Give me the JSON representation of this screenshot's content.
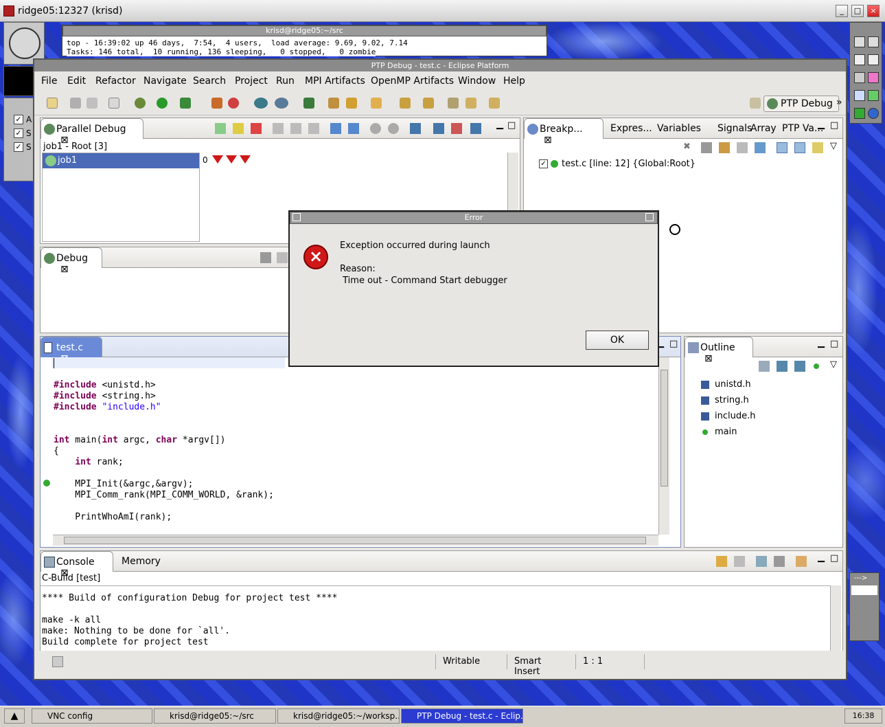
{
  "x_window": {
    "title": "ridge05:12327 (krisd)"
  },
  "terminal": {
    "title": "krisd@ridge05:~/src",
    "line1": "top - 16:39:02 up 46 days,  7:54,  4 users,  load average: 9.69, 9.02, 7.14",
    "line2": "Tasks: 146 total,  10 running, 136 sleeping,   0 stopped,   0 zombie"
  },
  "left_panel": {
    "checks": [
      "A",
      "S",
      "S"
    ]
  },
  "eclipse": {
    "title": "PTP Debug - test.c - Eclipse Platform",
    "menu": [
      "File",
      "Edit",
      "Refactor",
      "Navigate",
      "Search",
      "Project",
      "Run",
      "MPI Artifacts",
      "OpenMP Artifacts",
      "Window",
      "Help"
    ],
    "perspective": "PTP Debug",
    "parallel_debug": {
      "tab": "Parallel Debug",
      "root": "job1 - Root [3]",
      "job": "job1",
      "process_index": "0"
    },
    "breakpoints_tabs": [
      "Breakp...",
      "Expres...",
      "Variables",
      "Signals",
      "Array",
      "PTP Va..."
    ],
    "breakpoint_entry": "test.c [line: 12] {Global:Root}",
    "debug_tab": "Debug",
    "editor": {
      "tab": "test.c",
      "lines": [
        {
          "parts": [
            [
              "",
              ""
            ]
          ]
        },
        {
          "parts": [
            [
              "",
              ""
            ]
          ]
        },
        {
          "parts": [
            [
              "kw",
              "#include"
            ],
            [
              "",
              " <unistd.h>"
            ]
          ]
        },
        {
          "parts": [
            [
              "kw",
              "#include"
            ],
            [
              "",
              " <string.h>"
            ]
          ]
        },
        {
          "parts": [
            [
              "kw",
              "#include"
            ],
            [
              "",
              " "
            ],
            [
              "str",
              "\"include.h\""
            ]
          ]
        },
        {
          "parts": [
            [
              "",
              ""
            ]
          ]
        },
        {
          "parts": [
            [
              "",
              ""
            ]
          ]
        },
        {
          "parts": [
            [
              "kw",
              "int"
            ],
            [
              "",
              " main("
            ],
            [
              "kw",
              "int"
            ],
            [
              "",
              " argc, "
            ],
            [
              "kw",
              "char"
            ],
            [
              "",
              " *argv[])"
            ]
          ]
        },
        {
          "parts": [
            [
              "",
              "{"
            ]
          ]
        },
        {
          "parts": [
            [
              "",
              "    "
            ],
            [
              "kw",
              "int"
            ],
            [
              "",
              " rank;"
            ]
          ]
        },
        {
          "parts": [
            [
              "",
              ""
            ]
          ]
        },
        {
          "parts": [
            [
              "",
              "    MPI_Init(&argc,&argv);"
            ]
          ]
        },
        {
          "parts": [
            [
              "",
              "    MPI_Comm_rank(MPI_COMM_WORLD, &rank);"
            ]
          ]
        },
        {
          "parts": [
            [
              "",
              ""
            ]
          ]
        },
        {
          "parts": [
            [
              "",
              "    PrintWhoAmI(rank);"
            ]
          ]
        }
      ]
    },
    "outline": {
      "tab": "Outline",
      "items": [
        "unistd.h",
        "string.h",
        "include.h",
        "main"
      ]
    },
    "console": {
      "tabs": [
        "Console",
        "Memory"
      ],
      "header": "C-Build [test]",
      "lines": [
        "**** Build of configuration Debug for project test ****",
        "",
        "make -k all",
        "make: Nothing to be done for `all'.",
        "Build complete for project test"
      ]
    },
    "status": {
      "writable": "Writable",
      "insert": "Smart Insert",
      "position": "1 : 1"
    }
  },
  "dialog": {
    "title": "Error",
    "message": "Exception occurred during launch",
    "reason_label": "Reason:",
    "reason": " Time out - Command Start debugger",
    "ok": "OK"
  },
  "taskbar": {
    "tasks": [
      "VNC config",
      "krisd@ridge05:~/src",
      "krisd@ridge05:~/worksp...",
      "PTP Debug - test.c - Eclip..."
    ],
    "clock": "16:38"
  },
  "right_dock": {
    "label": "--->"
  },
  "colors": {
    "error": "#d01818",
    "selection": "#4a6ab8",
    "keyword": "#7f0055",
    "string": "#2a00ff",
    "desktop": "#2a3fd0"
  }
}
